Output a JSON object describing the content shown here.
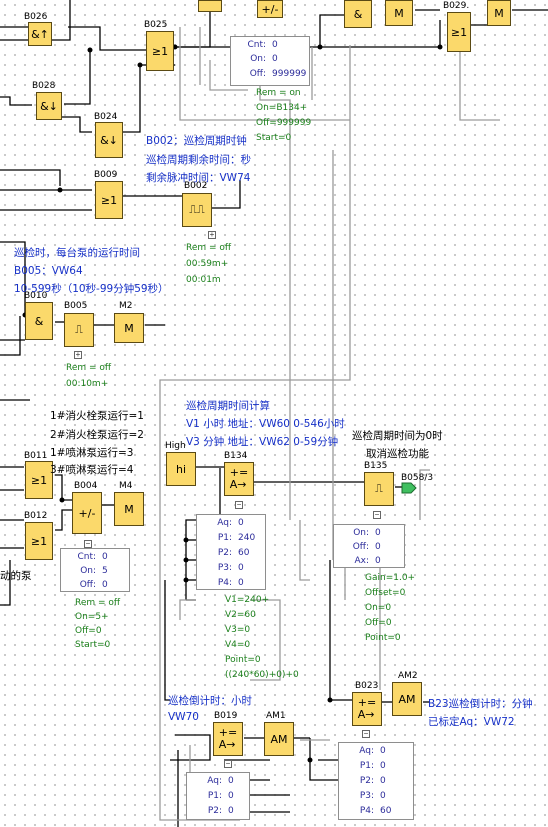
{
  "blocks": {
    "b026": {
      "name": "B026",
      "sym": "&↑"
    },
    "b025": {
      "name": "B025",
      "sym": "≥1"
    },
    "b028": {
      "name": "B028",
      "sym": "&↓"
    },
    "b024": {
      "name": "B024",
      "sym": "&↓"
    },
    "b009": {
      "name": "B009",
      "sym": "≥1"
    },
    "b002": {
      "name": "B002",
      "sym": "⎍⎍"
    },
    "b010": {
      "name": "B010",
      "sym": "&"
    },
    "b005": {
      "name": "B005",
      "sym": "⎍"
    },
    "m2": {
      "name": "M2",
      "sym": "M"
    },
    "b011": {
      "name": "B011",
      "sym": "≥1"
    },
    "b004": {
      "name": "B004",
      "sym": "+/-"
    },
    "m4": {
      "name": "M4",
      "sym": "M"
    },
    "b012": {
      "name": "B012",
      "sym": "≥1"
    },
    "high": {
      "name": "High",
      "sym": "hi"
    },
    "b134": {
      "name": "B134",
      "sym": "+=\nA→"
    },
    "b135": {
      "name": "B135",
      "sym": "⎍"
    },
    "b058": {
      "name": "B058/3"
    },
    "b023": {
      "name": "B023",
      "sym": "+=\nA→"
    },
    "am2": {
      "name": "AM2",
      "sym": "AM"
    },
    "b019": {
      "name": "B019",
      "sym": "+=\nA→"
    },
    "am1": {
      "name": "AM1",
      "sym": "AM"
    },
    "b029": {
      "name": "B029.",
      "sym": "≥1"
    },
    "top_pm": {
      "sym": "+/-"
    },
    "top_and": {
      "sym": "&"
    },
    "top_m1": {
      "sym": "M"
    },
    "top_m2": {
      "sym": "M"
    }
  },
  "comments": {
    "b002_title": "B002：巡检周期时钟",
    "b002_remain": "巡检周期剩余时间：秒",
    "b002_pulse": "剩余脉冲时间：VW74",
    "run_time": "巡检时，每台泵的运行时间",
    "b005_addr": "B005：VW64",
    "b005_range": "10-599秒（10秒-99分钟59秒）",
    "pump1": "1#消火栓泵运行=1",
    "pump2": "2#消火栓泵运行=2",
    "pump3": "1#喷淋泵运行=3",
    "pump4": "3#喷淋泵运行=4",
    "pump_frag": "动的泵",
    "period_calc": "巡检周期时间计算",
    "v1": "V1 小时 地址：VW60 0-546小时",
    "v3": "V3 分钟 地址：VW62 0-59分钟",
    "zero1": "巡检周期时间为0时",
    "zero2": "取消巡检功能",
    "countdown_h": "巡检倒计时：小时",
    "vw70": "VW70",
    "b23_title": "B23巡检倒计时：分钟",
    "b23_aq": "已标定Aq：VW72"
  },
  "params": {
    "top_cnt": [
      {
        "k": "Cnt",
        "v": "0"
      },
      {
        "k": "On",
        "v": "0"
      },
      {
        "k": "Off",
        "v": "999999"
      }
    ],
    "top_rem": [
      "Rem = on",
      "On=B134+",
      "Off=999999",
      "Start=0"
    ],
    "b002": [
      "Rem = off",
      "00:59m+",
      "00:01m"
    ],
    "b005": [
      "Rem = off",
      "00:10m+"
    ],
    "b004_tbl": [
      {
        "k": "Cnt",
        "v": "0"
      },
      {
        "k": "On",
        "v": "5"
      },
      {
        "k": "Off",
        "v": "0"
      }
    ],
    "b004": [
      "Rem = off",
      "On=5+",
      "Off=0",
      "Start=0"
    ],
    "b134_tbl": [
      {
        "k": "Aq",
        "v": "0"
      },
      {
        "k": "P1",
        "v": "240"
      },
      {
        "k": "P2",
        "v": "60"
      },
      {
        "k": "P3",
        "v": "0"
      },
      {
        "k": "P4",
        "v": "0"
      }
    ],
    "b134": [
      "V1=240+",
      "V2=60",
      "V3=0",
      "V4=0",
      "Point=0",
      "((240*60)+0)+0"
    ],
    "b135_tbl": [
      {
        "k": "On",
        "v": "0"
      },
      {
        "k": "Off",
        "v": "0"
      },
      {
        "k": "Ax",
        "v": "0"
      }
    ],
    "b135": [
      "Gain=1.0+",
      "Offset=0",
      "On=0",
      "Off=0",
      "Point=0"
    ],
    "b023_tbl": [
      {
        "k": "Aq",
        "v": "0"
      },
      {
        "k": "P1",
        "v": "0"
      },
      {
        "k": "P2",
        "v": "0"
      },
      {
        "k": "P3",
        "v": "0"
      },
      {
        "k": "P4",
        "v": "60"
      }
    ],
    "b019_tbl": [
      {
        "k": "Aq",
        "v": "0"
      },
      {
        "k": "P1",
        "v": "0"
      },
      {
        "k": "P2",
        "v": "0"
      }
    ]
  }
}
